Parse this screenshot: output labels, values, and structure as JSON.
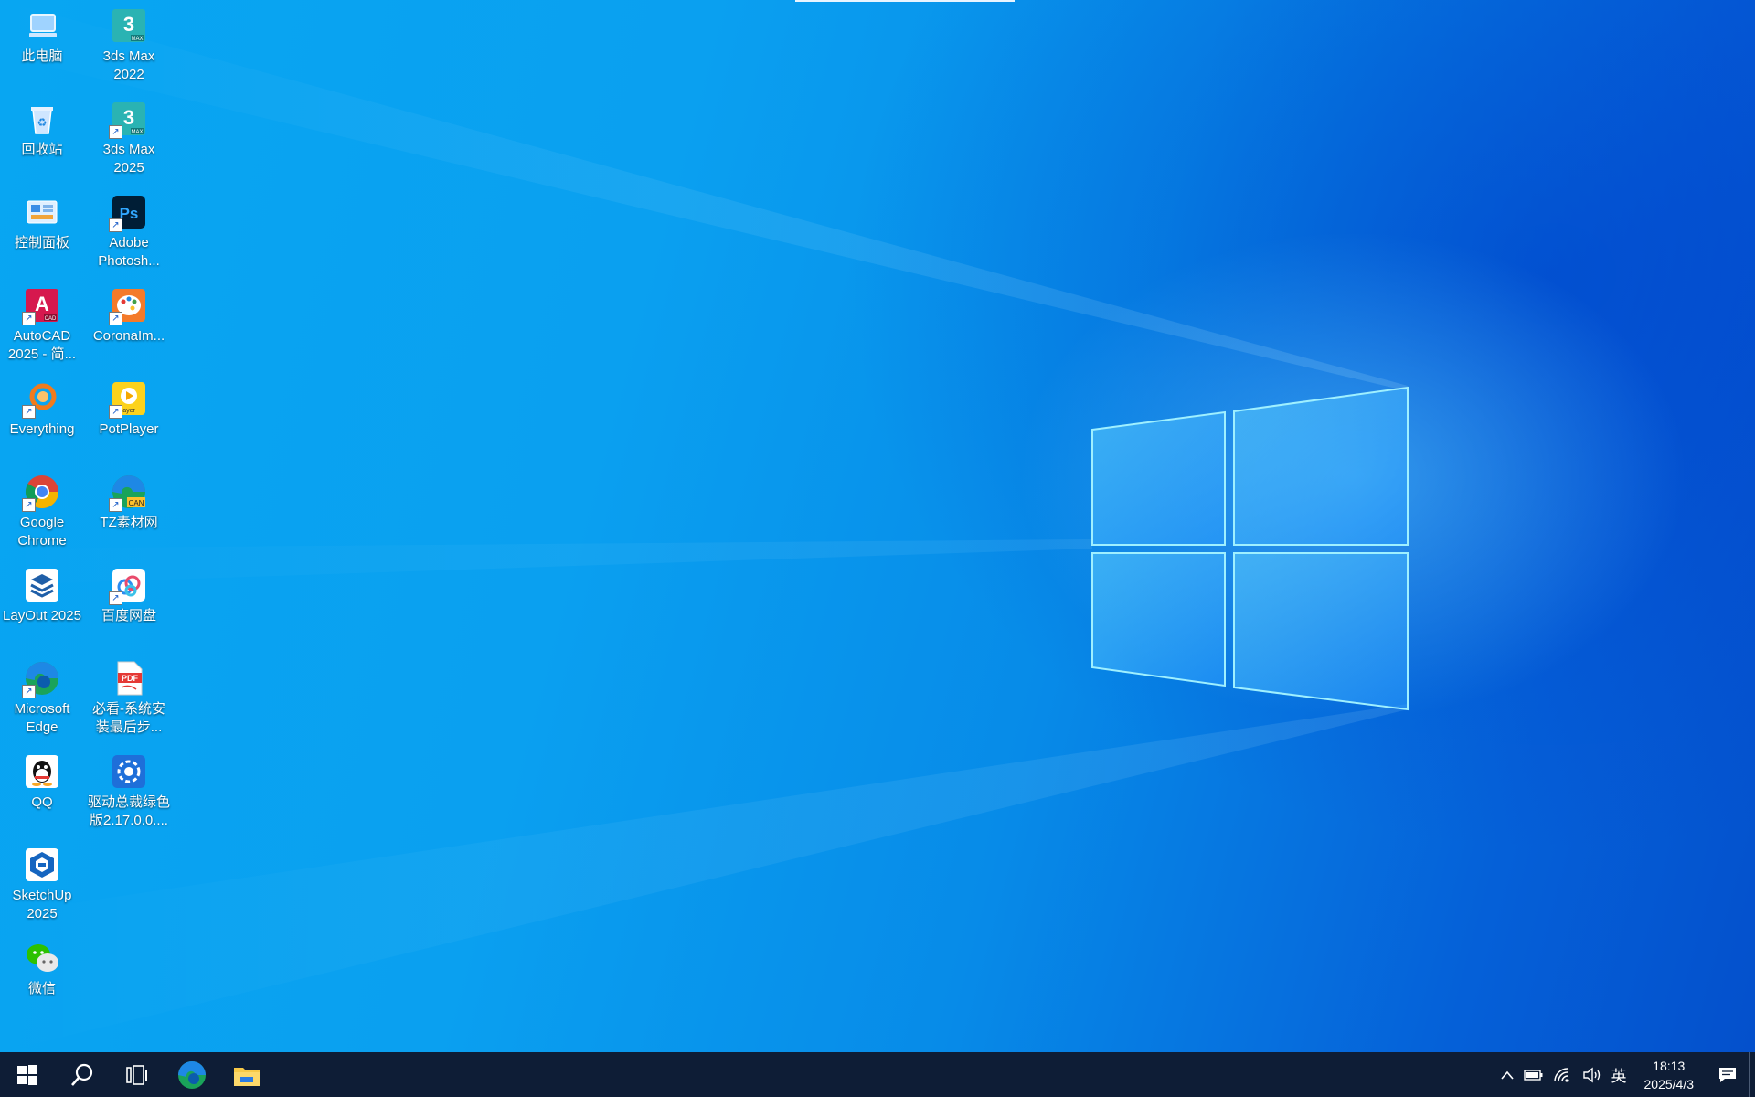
{
  "desktop": {
    "icons": [
      {
        "label": "此电脑",
        "icon": "computer-icon"
      },
      {
        "label": "3ds Max 2022",
        "icon": "3dsmax-icon"
      },
      {
        "label": "回收站",
        "icon": "recycle-bin-icon"
      },
      {
        "label": "3ds Max 2025",
        "icon": "3dsmax-icon"
      },
      {
        "label": "控制面板",
        "icon": "control-panel-icon"
      },
      {
        "label": "Adobe Photosh...",
        "icon": "photoshop-icon"
      },
      {
        "label": "AutoCAD 2025 - 简...",
        "icon": "autocad-icon"
      },
      {
        "label": "CoronaIm...",
        "icon": "corona-icon"
      },
      {
        "label": "Everything",
        "icon": "everything-icon"
      },
      {
        "label": "PotPlayer",
        "icon": "potplayer-icon"
      },
      {
        "label": "Google Chrome",
        "icon": "chrome-icon"
      },
      {
        "label": "TZ素材网",
        "icon": "tz-icon"
      },
      {
        "label": "LayOut 2025",
        "icon": "layout-icon"
      },
      {
        "label": "百度网盘",
        "icon": "baidu-netdisk-icon"
      },
      {
        "label": "Microsoft Edge",
        "icon": "edge-icon"
      },
      {
        "label": "必看-系统安装最后步...",
        "icon": "pdf-icon"
      },
      {
        "label": "QQ",
        "icon": "qq-icon"
      },
      {
        "label": "驱动总裁绿色版2.17.0.0....",
        "icon": "driver-icon"
      },
      {
        "label": "SketchUp 2025",
        "icon": "sketchup-icon"
      },
      {
        "label": "微信",
        "icon": "wechat-icon"
      }
    ]
  },
  "taskbar": {
    "start": "windows-start-icon",
    "search": "search-icon",
    "taskview": "task-view-icon",
    "pinned": [
      "edge-icon",
      "file-explorer-icon"
    ],
    "tray": {
      "ime": "英",
      "time": "18:13",
      "date": "2025/4/3"
    }
  },
  "colors": {
    "taskbar": "#0e1d36",
    "wallpaper": "#0a9af0"
  }
}
